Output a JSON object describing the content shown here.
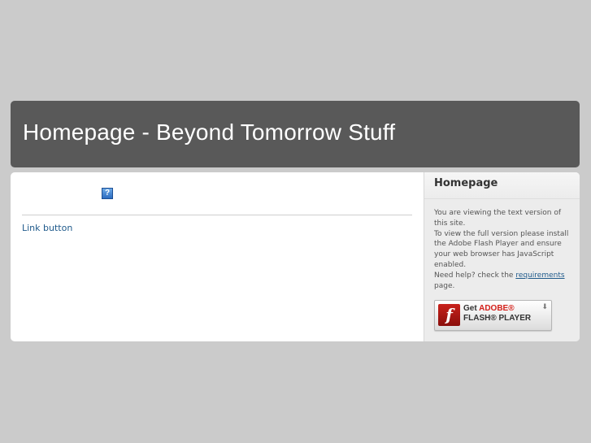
{
  "header": {
    "title": "Homepage - Beyond Tomorrow Stuff"
  },
  "main": {
    "help_icon_glyph": "?",
    "link_button_label": "Link button"
  },
  "sidebar": {
    "title": "Homepage",
    "line1": "You are viewing the text version of this site.",
    "line2": "To view the full version please install the Adobe Flash Player and ensure your web browser has JavaScript enabled.",
    "line3_prefix": "Need help? check the",
    "line3_link": "requirements",
    "line3_suffix": "page."
  },
  "flash_badge": {
    "logo_glyph": "f",
    "line1_prefix": "Get",
    "line1_brand": "ADOBE®",
    "line2": "FLASH® PLAYER",
    "arrow_glyph": "⬇"
  },
  "colors": {
    "page_bg": "#cbcbcb",
    "header_bg": "#595959",
    "link": "#1f5a8b",
    "adobe_red": "#d4201a"
  }
}
